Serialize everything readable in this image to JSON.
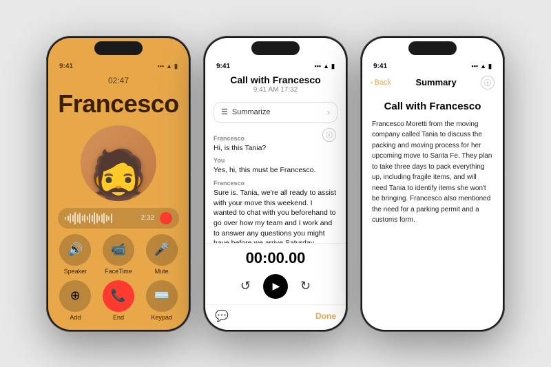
{
  "phone1": {
    "status_time": "9:41",
    "call_duration_display": "02:47",
    "caller_name": "Francesco",
    "waveform_time": "2:32",
    "controls": [
      {
        "icon": "🔊",
        "label": "Speaker"
      },
      {
        "icon": "📹",
        "label": "FaceTime"
      },
      {
        "icon": "🎤",
        "label": "Mute"
      },
      {
        "icon": "👤",
        "label": "Add"
      },
      {
        "icon": "📞",
        "label": "End",
        "type": "end"
      },
      {
        "icon": "⌨️",
        "label": "Keypad"
      }
    ]
  },
  "phone2": {
    "status_time": "9:41",
    "title": "Call with Francesco",
    "time": "9:41 AM  17:32",
    "summarize_label": "Summarize",
    "messages": [
      {
        "speaker": "Francesco",
        "text": "Hi, is this Tania?"
      },
      {
        "speaker": "You",
        "text": "Yes, hi, this must be Francesco.",
        "bold": true
      },
      {
        "speaker": "Francesco",
        "text": "Sure is. Tania, we're all ready to assist with your move this weekend. I wanted to chat with you beforehand to go over how my team and I work and to answer any questions you might have before we arrive Saturday"
      }
    ],
    "timer": "00:00.00",
    "done_label": "Done"
  },
  "phone3": {
    "status_time": "9:41",
    "back_label": "Back",
    "nav_title": "Summary",
    "call_title": "Call with Francesco",
    "summary_text": "Francesco Moretti from the moving company called Tania to discuss the packing and moving process for her upcoming move to Santa Fe. They plan to take three days to pack everything up, including fragile items, and will need Tania to identify items she won't be bringing. Francesco also mentioned the need for a parking permit and a customs form."
  }
}
